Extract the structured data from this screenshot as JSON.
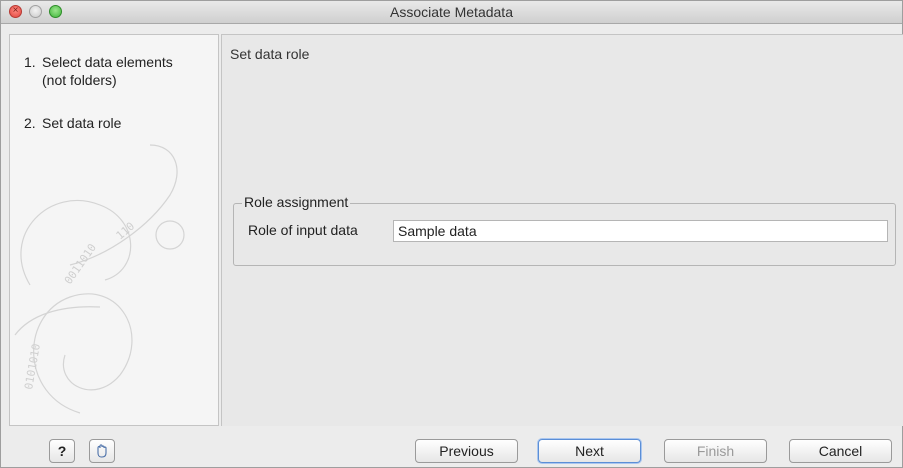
{
  "window": {
    "title": "Associate Metadata"
  },
  "steps": [
    {
      "number": "1.",
      "label": "Select data elements",
      "sublabel": "(not folders)"
    },
    {
      "number": "2.",
      "label": "Set data role"
    }
  ],
  "content": {
    "title": "Set data role",
    "group_title": "Role assignment",
    "role_label": "Role of input data",
    "role_value": "Sample data"
  },
  "footer": {
    "help_label": "?",
    "previous_label": "Previous",
    "next_label": "Next",
    "finish_label": "Finish",
    "cancel_label": "Cancel"
  },
  "icons": {
    "help": "question-icon",
    "wand": "undo-hand-icon"
  },
  "colors": {
    "default_button": "#5b8ed6",
    "close": "#e0443e",
    "maximize": "#3fb53a"
  }
}
